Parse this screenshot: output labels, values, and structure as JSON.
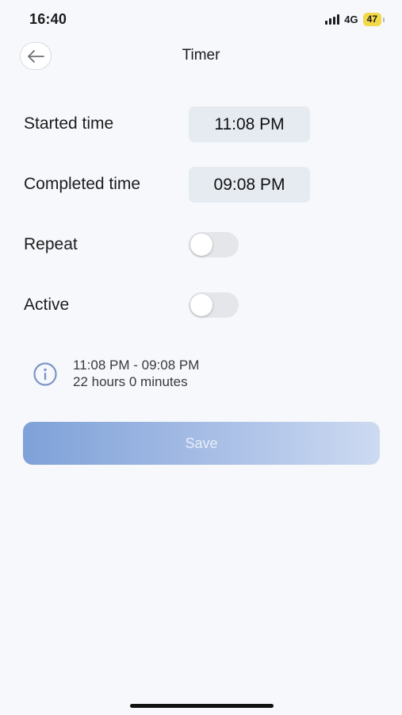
{
  "status_bar": {
    "time": "16:40",
    "network": "4G",
    "battery": "47",
    "battery_color": "#f3d84a"
  },
  "header": {
    "back_icon": "arrow-left-icon",
    "title": "Timer"
  },
  "form": {
    "started_label": "Started time",
    "started_value": "11:08 PM",
    "completed_label": "Completed time",
    "completed_value": "09:08 PM",
    "repeat_label": "Repeat",
    "repeat_on": false,
    "active_label": "Active",
    "active_on": false
  },
  "info": {
    "icon": "info-icon",
    "range": "11:08 PM - 09:08 PM",
    "duration": "22 hours 0 minutes"
  },
  "save": {
    "label": "Save"
  },
  "colors": {
    "accent": "#7ea1d8",
    "background": "#f6f8fb",
    "pill": "#e6ebf2"
  }
}
